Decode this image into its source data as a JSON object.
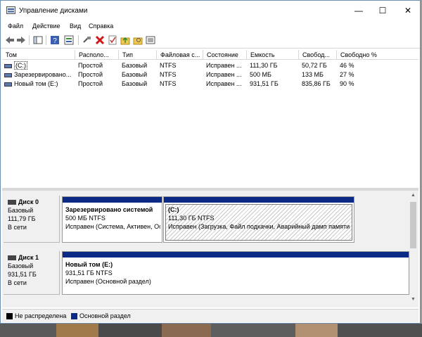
{
  "window": {
    "title": "Управление дисками",
    "minimize": "—",
    "maximize": "☐",
    "close": "✕"
  },
  "menu": [
    "Файл",
    "Действие",
    "Вид",
    "Справка"
  ],
  "toolbar": [
    "back-icon",
    "forward-icon",
    "console-tree-icon",
    "help-icon",
    "properties-icon",
    "connect-icon",
    "delete-icon",
    "check-icon",
    "folder-up-icon",
    "folder-search-icon",
    "list-icon"
  ],
  "columns": [
    "Том",
    "Располо...",
    "Тип",
    "Файловая с...",
    "Состояние",
    "Емкость",
    "Свобод...",
    "Свободно %"
  ],
  "volumes": [
    [
      "(C:)",
      "Простой",
      "Базовый",
      "NTFS",
      "Исправен ...",
      "111,30 ГБ",
      "50,72 ГБ",
      "46 %"
    ],
    [
      "Зарезервировано...",
      "Простой",
      "Базовый",
      "NTFS",
      "Исправен ...",
      "500 МБ",
      "133 МБ",
      "27 %"
    ],
    [
      "Новый том (E:)",
      "Простой",
      "Базовый",
      "NTFS",
      "Исправен ...",
      "931,51 ГБ",
      "835,86 ГБ",
      "90 %"
    ]
  ],
  "disks": [
    {
      "name": "Диск 0",
      "type": "Базовый",
      "size": "111,79 ГБ",
      "status": "В сети",
      "partitions": [
        {
          "name": "Зарезервировано системой",
          "size": "500 МБ NTFS",
          "status": "Исправен (Система, Активен, Основной раздел)"
        },
        {
          "name": "(C:)",
          "size": "111,30 ГБ NTFS",
          "status": "Исправен (Загрузка, Файл подкачки, Аварийный дамп памяти, Основной раздел)"
        }
      ]
    },
    {
      "name": "Диск 1",
      "type": "Базовый",
      "size": "931,51 ГБ",
      "status": "В сети",
      "partitions": [
        {
          "name": "Новый том  (E:)",
          "size": "931,51 ГБ NTFS",
          "status": "Исправен (Основной раздел)"
        }
      ]
    }
  ],
  "legend": [
    {
      "label": "Не распределена",
      "color": "#000000"
    },
    {
      "label": "Основной раздел",
      "color": "#0a2a85"
    }
  ]
}
